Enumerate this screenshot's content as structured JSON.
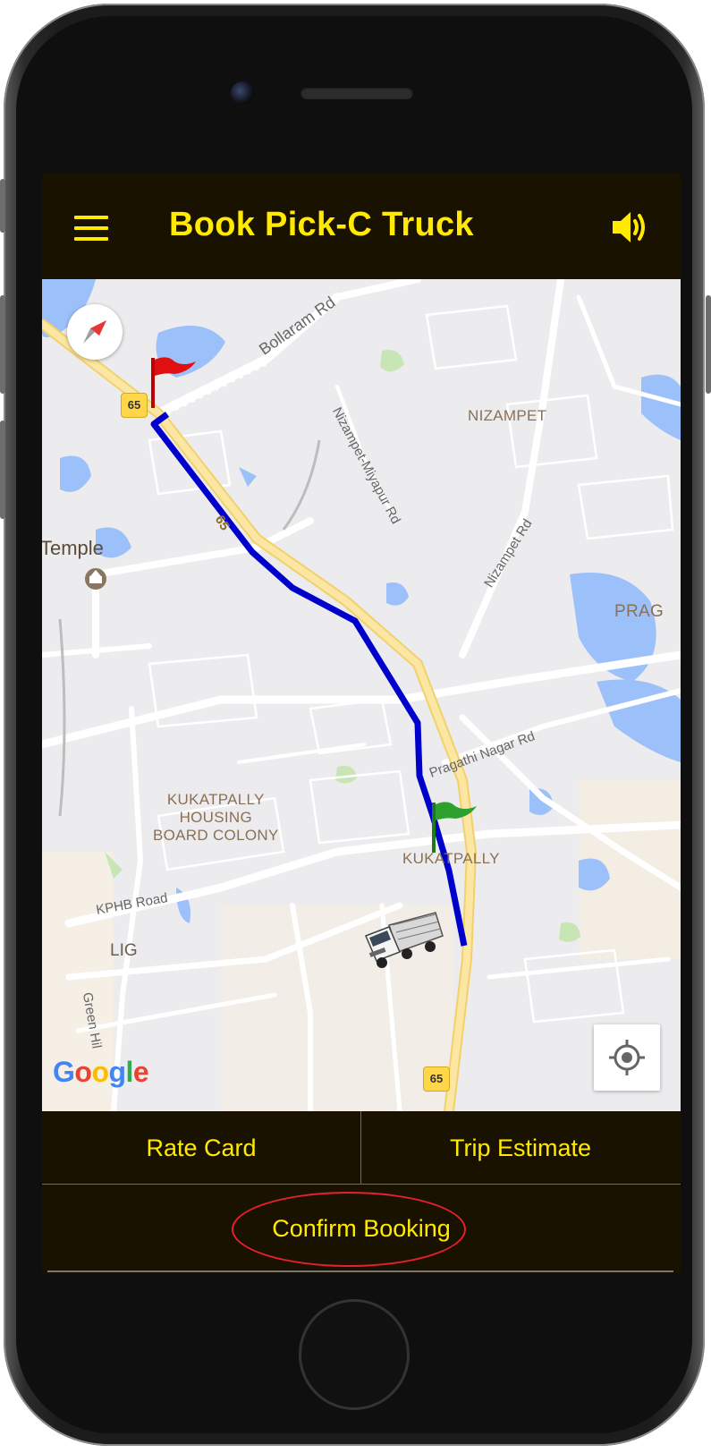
{
  "app": {
    "title": "Book Pick-C Truck"
  },
  "icons": {
    "menu": "hamburger-menu-icon",
    "sound": "speaker-volume-icon",
    "compass": "compass-icon",
    "my_location": "my-location-icon",
    "pickup_flag": "red-flag-icon",
    "drop_flag": "green-flag-icon",
    "truck": "truck-icon"
  },
  "map": {
    "labels": {
      "bollaram_rd": "Bollaram Rd",
      "nizampet": "NIZAMPET",
      "nizampet_miyapur_rd": "Nizampet-Miyapur Rd",
      "nizampet_rd": "Nizampet Rd",
      "temple": "Temple",
      "prag": "PRAG",
      "pragathi_nagar_rd": "Pragathi Nagar Rd",
      "kukatpally_housing": "KUKATPALLY\nHOUSING\nBOARD COLONY",
      "kukatpally": "KUKATPALLY",
      "kphb_road": "KPHB Road",
      "lig": "LIG",
      "green_hills": "Green Hil",
      "route_65_a": "65",
      "route_65_b": "65",
      "route_65_c": "65"
    },
    "google_logo": "Google"
  },
  "buttons": {
    "rate_card": "Rate Card",
    "trip_estimate": "Trip Estimate",
    "confirm_booking": "Confirm Booking"
  },
  "colors": {
    "accent_yellow": "#ffea00",
    "bar_background": "#1a1200",
    "route_blue": "#0000cc",
    "highlight_red": "#e8202a"
  }
}
